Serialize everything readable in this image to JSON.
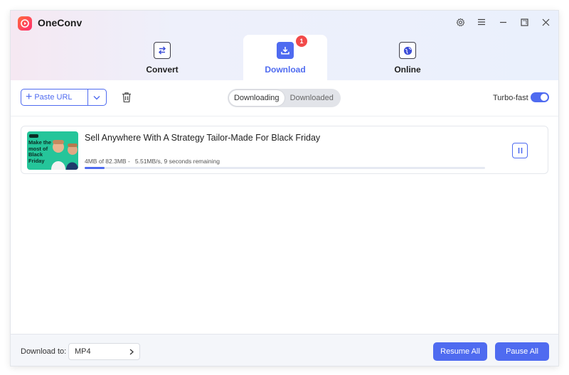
{
  "app": {
    "title": "OneConv"
  },
  "tabs": [
    {
      "label": "Convert",
      "icon": "convert-arrows-icon"
    },
    {
      "label": "Download",
      "icon": "download-tray-icon",
      "badge": "1"
    },
    {
      "label": "Online",
      "icon": "globe-icon"
    }
  ],
  "toolbar": {
    "paste_url_label": "Paste URL",
    "segment": [
      "Downloading",
      "Downloaded"
    ],
    "segment_selected": "Downloading",
    "turbo_label": "Turbo-fast",
    "turbo_on": true
  },
  "downloads": [
    {
      "title": "Sell Anywhere With A Strategy Tailor-Made For Black Friday",
      "progress_text": "4MB of 82.3MB -",
      "speed_text": "5.51MB/s, 9 seconds remaining",
      "progress_fraction": 0.05,
      "thumbnail_text": "Make the most of Black Friday"
    }
  ],
  "footer": {
    "download_to_label": "Download to:",
    "format_value": "MP4",
    "resume_all_label": "Resume All",
    "pause_all_label": "Pause All"
  },
  "colors": {
    "accent": "#4f6bf0",
    "badge": "#f24a4a",
    "thumbnail_bg": "#25c59a"
  }
}
